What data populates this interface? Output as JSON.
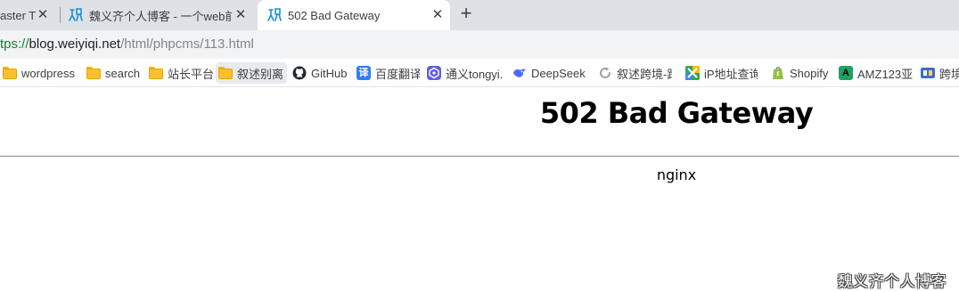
{
  "tabs": [
    {
      "title": "aster T",
      "close": "✕"
    },
    {
      "title": "魏义齐个人博客 - 一个web前",
      "close": "✕"
    },
    {
      "title": "502 Bad Gateway",
      "close": "✕"
    }
  ],
  "new_tab_symbol": "+",
  "address": {
    "scheme": "tps://",
    "host": "blog.weiyiqi.net",
    "path": "/html/phpcms/113.html"
  },
  "bookmarks": [
    {
      "label": "wordpress",
      "icon": "folder-icon"
    },
    {
      "label": "search",
      "icon": "folder-icon"
    },
    {
      "label": "站长平台",
      "icon": "folder-icon"
    },
    {
      "label": "叙述别离",
      "icon": "folder-icon"
    },
    {
      "label": "GitHub",
      "icon": "github-icon"
    },
    {
      "label": "百度翻译",
      "icon": "baidu-translate-icon"
    },
    {
      "label": "通义tongyi.",
      "icon": "tongyi-icon"
    },
    {
      "label": "DeepSeek",
      "icon": "deepseek-icon"
    },
    {
      "label": "叙述跨境-跨",
      "icon": "refresh-logo-icon"
    },
    {
      "label": "iP地址查询",
      "icon": "ip-lookup-icon"
    },
    {
      "label": "Shopify",
      "icon": "shopify-icon"
    },
    {
      "label": "AMZ123亚",
      "icon": "amz123-icon"
    },
    {
      "label": "跨境",
      "icon": "crossborder-icon"
    }
  ],
  "page": {
    "heading": "502 Bad Gateway",
    "server": "nginx"
  },
  "watermark": "魏义齐个人博客",
  "colors": {
    "tabstrip": "#dee1e6",
    "addressbar": "#f1f3f4",
    "url_scheme": "#188038",
    "url_path": "#80868b"
  }
}
